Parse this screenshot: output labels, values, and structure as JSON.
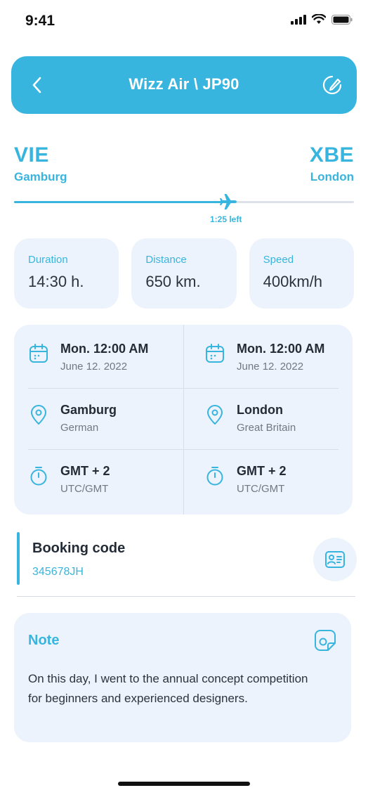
{
  "status_bar": {
    "time": "9:41"
  },
  "header": {
    "title": "Wizz Air \\ JP90"
  },
  "route": {
    "from_code": "VIE",
    "from_city": "Gamburg",
    "to_code": "XBE",
    "to_city": "London",
    "time_left": "1:25 left",
    "progress": 0.63
  },
  "stats": [
    {
      "label": "Duration",
      "value": "14:30 h."
    },
    {
      "label": "Distance",
      "value": "650 km."
    },
    {
      "label": "Speed",
      "value": "400km/h"
    }
  ],
  "details": {
    "departure": {
      "datetime": "Mon. 12:00 AM",
      "date": "June 12. 2022",
      "city": "Gamburg",
      "country": "German",
      "timezone": "GMT + 2",
      "timezone_label": "UTC/GMT"
    },
    "arrival": {
      "datetime": "Mon. 12:00 AM",
      "date": "June 12. 2022",
      "city": "London",
      "country": "Great Britain",
      "timezone": "GMT + 2",
      "timezone_label": "UTC/GMT"
    }
  },
  "booking": {
    "label": "Booking code",
    "code": "345678JH"
  },
  "note": {
    "title": "Note",
    "text": "On this day, I went to the annual concept competition for beginners and experienced designers."
  },
  "colors": {
    "accent": "#38b5de",
    "card": "#edf3fc",
    "text": "#222b36",
    "muted": "#6f7884"
  },
  "icons": [
    "back-arrow-icon",
    "edit-icon",
    "plane-icon",
    "calendar-icon",
    "location-pin-icon",
    "stopwatch-icon",
    "id-card-icon",
    "note-icon"
  ]
}
